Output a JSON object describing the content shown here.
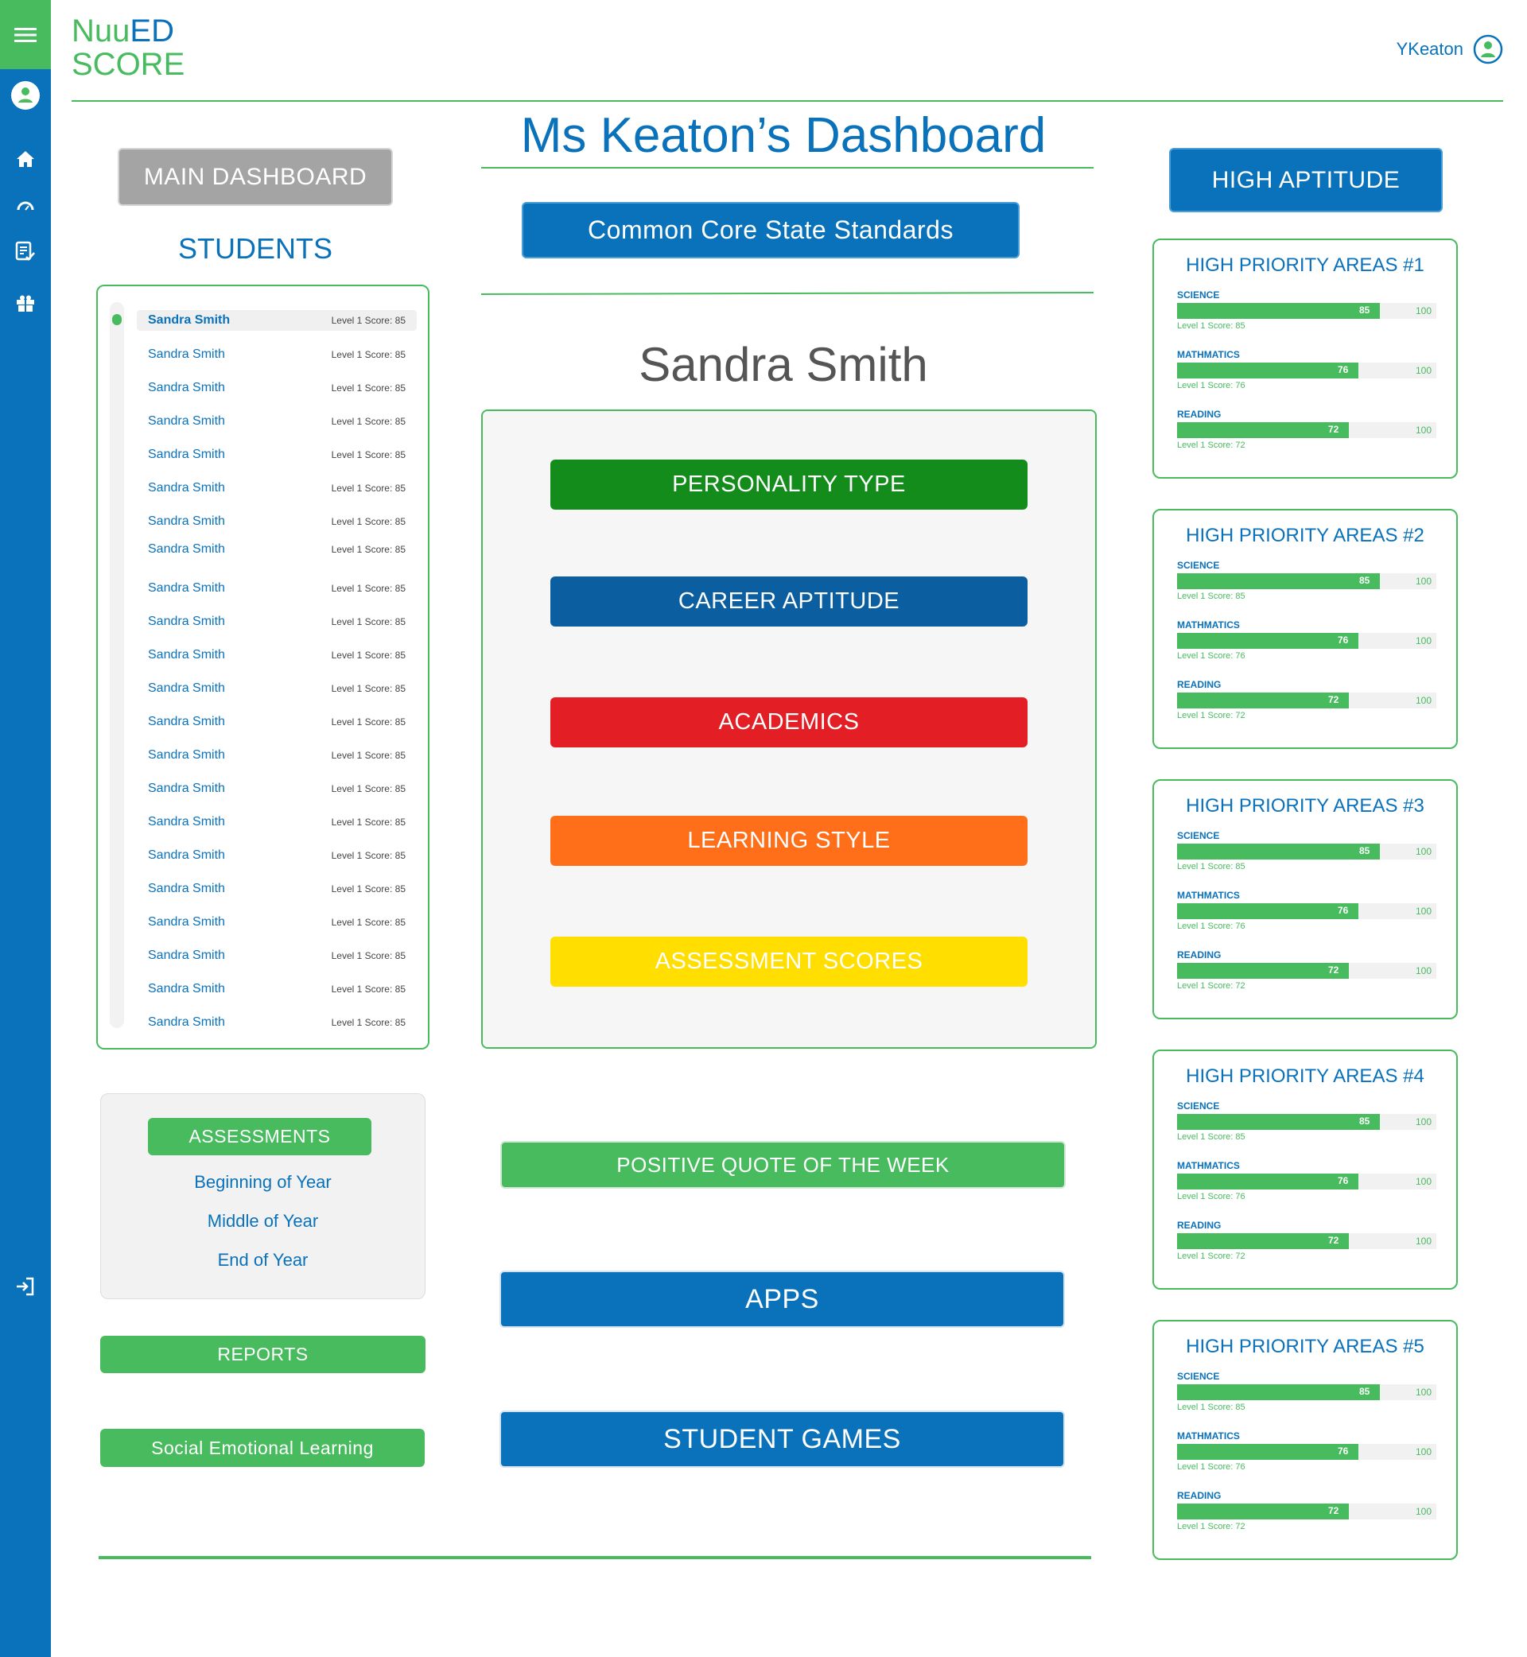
{
  "app": {
    "logo_line1": "Nuu",
    "logo_line1b": "ED",
    "logo_line2": "SCORE",
    "username": "YKeaton"
  },
  "sidebar": {
    "icons": [
      "menu-icon",
      "user-icon",
      "home-icon",
      "dashboard-gauge-icon",
      "checklist-icon",
      "gift-icon",
      "logout-icon"
    ]
  },
  "colors": {
    "blue": "#0a72ba",
    "green": "#48bb5f",
    "red": "#e31e24",
    "orange": "#ff6f1a",
    "yellow": "#ffde00",
    "darkgreen": "#138c1c",
    "gray": "#a4a4a4"
  },
  "left": {
    "main_dashboard": "MAIN DASHBOARD",
    "students_heading": "STUDENTS",
    "students": [
      {
        "name": "Sandra Smith",
        "score": "Level 1 Score: 85"
      },
      {
        "name": "Sandra Smith",
        "score": "Level 1 Score: 85"
      },
      {
        "name": "Sandra Smith",
        "score": "Level 1 Score: 85"
      },
      {
        "name": "Sandra Smith",
        "score": "Level 1 Score: 85"
      },
      {
        "name": "Sandra Smith",
        "score": "Level 1 Score: 85"
      },
      {
        "name": "Sandra Smith",
        "score": "Level 1 Score: 85"
      },
      {
        "name": "Sandra Smith",
        "score": "Level 1 Score: 85"
      },
      {
        "name": "Sandra Smith",
        "score": "Level 1 Score: 85"
      },
      {
        "name": "Sandra Smith",
        "score": "Level 1 Score: 85"
      },
      {
        "name": "Sandra Smith",
        "score": "Level 1 Score: 85"
      },
      {
        "name": "Sandra Smith",
        "score": "Level 1 Score: 85"
      },
      {
        "name": "Sandra Smith",
        "score": "Level 1 Score: 85"
      },
      {
        "name": "Sandra Smith",
        "score": "Level 1 Score: 85"
      },
      {
        "name": "Sandra Smith",
        "score": "Level 1 Score: 85"
      },
      {
        "name": "Sandra Smith",
        "score": "Level 1 Score: 85"
      },
      {
        "name": "Sandra Smith",
        "score": "Level 1 Score: 85"
      },
      {
        "name": "Sandra Smith",
        "score": "Level 1 Score: 85"
      },
      {
        "name": "Sandra Smith",
        "score": "Level 1 Score: 85"
      },
      {
        "name": "Sandra Smith",
        "score": "Level 1 Score: 85"
      },
      {
        "name": "Sandra Smith",
        "score": "Level 1 Score: 85"
      },
      {
        "name": "Sandra Smith",
        "score": "Level 1 Score: 85"
      },
      {
        "name": "Sandra Smith",
        "score": "Level 1 Score: 85"
      }
    ],
    "assessments": "ASSESSMENTS",
    "assessment_links": [
      "Beginning of Year",
      "Middle of Year",
      "End of Year"
    ],
    "reports": "REPORTS",
    "sel": "Social Emotional Learning"
  },
  "center": {
    "title": "Ms Keaton’s Dashboard",
    "standards": "Common Core State Standards",
    "student_name": "Sandra Smith",
    "categories": [
      "PERSONALITY TYPE",
      "CAREER APTITUDE",
      "ACADEMICS",
      "LEARNING STYLE",
      "ASSESSMENT SCORES"
    ],
    "quote": "POSITIVE QUOTE OF THE WEEK",
    "apps": "APPS",
    "games": "STUDENT GAMES"
  },
  "right": {
    "high_aptitude": "HIGH APTITUDE",
    "areas": [
      {
        "title": "HIGH PRIORITY AREAS #1",
        "subjects": [
          {
            "name": "SCIENCE",
            "value": 85,
            "max": 100,
            "sub": "Level 1 Score: 85"
          },
          {
            "name": "MATHMATICS",
            "value": 76,
            "max": 100,
            "sub": "Level 1 Score: 76"
          },
          {
            "name": "READING",
            "value": 72,
            "max": 100,
            "sub": "Level 1 Score: 72"
          }
        ]
      },
      {
        "title": "HIGH PRIORITY AREAS #2",
        "subjects": [
          {
            "name": "SCIENCE",
            "value": 85,
            "max": 100,
            "sub": "Level 1 Score: 85"
          },
          {
            "name": "MATHMATICS",
            "value": 76,
            "max": 100,
            "sub": "Level 1 Score: 76"
          },
          {
            "name": "READING",
            "value": 72,
            "max": 100,
            "sub": "Level 1 Score: 72"
          }
        ]
      },
      {
        "title": "HIGH PRIORITY AREAS #3",
        "subjects": [
          {
            "name": "SCIENCE",
            "value": 85,
            "max": 100,
            "sub": "Level 1 Score: 85"
          },
          {
            "name": "MATHMATICS",
            "value": 76,
            "max": 100,
            "sub": "Level 1 Score: 76"
          },
          {
            "name": "READING",
            "value": 72,
            "max": 100,
            "sub": "Level 1 Score: 72"
          }
        ]
      },
      {
        "title": "HIGH PRIORITY AREAS #4",
        "subjects": [
          {
            "name": "SCIENCE",
            "value": 85,
            "max": 100,
            "sub": "Level 1 Score: 85"
          },
          {
            "name": "MATHMATICS",
            "value": 76,
            "max": 100,
            "sub": "Level 1 Score: 76"
          },
          {
            "name": "READING",
            "value": 72,
            "max": 100,
            "sub": "Level 1 Score: 72"
          }
        ]
      },
      {
        "title": "HIGH PRIORITY AREAS #5",
        "subjects": [
          {
            "name": "SCIENCE",
            "value": 85,
            "max": 100,
            "sub": "Level 1 Score: 85"
          },
          {
            "name": "MATHMATICS",
            "value": 76,
            "max": 100,
            "sub": "Level 1 Score: 76"
          },
          {
            "name": "READING",
            "value": 72,
            "max": 100,
            "sub": "Level 1 Score: 72"
          }
        ]
      }
    ]
  }
}
